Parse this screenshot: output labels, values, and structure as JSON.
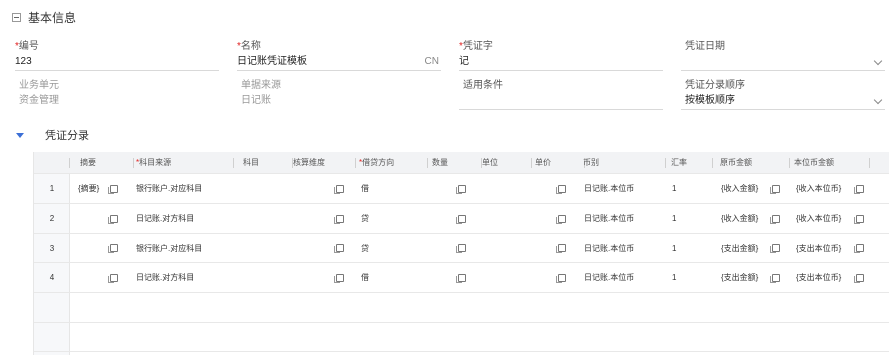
{
  "section": {
    "title": "基本信息"
  },
  "form": {
    "code": {
      "label": "编号",
      "value": "123"
    },
    "name": {
      "label": "名称",
      "value": "日记账凭证模板",
      "suffix": "CN"
    },
    "voucher_word": {
      "label": "凭证字",
      "value": "记"
    },
    "voucher_date": {
      "label": "凭证日期",
      "value": ""
    },
    "business_unit": {
      "label": "业务单元",
      "value": "资金管理"
    },
    "doc_source": {
      "label": "单据来源",
      "value": "日记账"
    },
    "condition": {
      "label": "适用条件",
      "value": ""
    },
    "entry_order": {
      "label": "凭证分录顺序",
      "value": "按模板顺序"
    }
  },
  "entries": {
    "title": "凭证分录",
    "columns": {
      "summary": "摘要",
      "subject_source": "科目来源",
      "subject": "科目",
      "dimension": "核算维度",
      "direction": "借贷方向",
      "qty": "数量",
      "unit": "单位",
      "price": "单价",
      "currency": "币别",
      "rate": "汇率",
      "orig_amount": "原币金额",
      "local_amount": "本位币金额"
    },
    "rows": [
      {
        "idx": "1",
        "summary": "{摘要}",
        "subject_source": "银行账户.对应科目",
        "direction": "借",
        "currency": "日记账.本位币",
        "rate": "1",
        "orig_amount": "{收入金额}",
        "local_amount": "{收入本位币}"
      },
      {
        "idx": "2",
        "summary": "",
        "subject_source": "日记账.对方科目",
        "direction": "贷",
        "currency": "日记账.本位币",
        "rate": "1",
        "orig_amount": "{收入金额}",
        "local_amount": "{收入本位币}"
      },
      {
        "idx": "3",
        "summary": "",
        "subject_source": "银行账户.对应科目",
        "direction": "贷",
        "currency": "日记账.本位币",
        "rate": "1",
        "orig_amount": "{支出金额}",
        "local_amount": "{支出本位币}"
      },
      {
        "idx": "4",
        "summary": "",
        "subject_source": "日记账.对方科目",
        "direction": "借",
        "currency": "日记账.本位币",
        "rate": "1",
        "orig_amount": "{支出金额}",
        "local_amount": "{支出本位币}"
      }
    ]
  }
}
